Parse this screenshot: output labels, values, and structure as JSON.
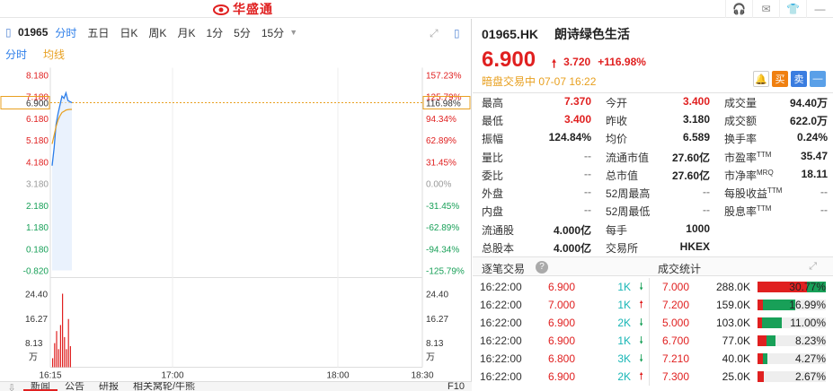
{
  "app": {
    "title": "华盛通",
    "window_icons": [
      "headset-icon",
      "mail-icon",
      "shirt-icon",
      "minimize-icon"
    ]
  },
  "toolbar": {
    "code": "01965",
    "tabs": [
      "分时",
      "五日",
      "日K",
      "周K",
      "月K",
      "1分",
      "5分",
      "15分"
    ],
    "active_tab": "分时"
  },
  "subtabs": {
    "intraday": "分时",
    "average": "均线"
  },
  "chart_data": {
    "type": "line",
    "price_axis_left": [
      "8.180",
      "7.180",
      "6.900",
      "6.180",
      "5.180",
      "4.180",
      "3.180",
      "2.180",
      "1.180",
      "0.180",
      "-0.820"
    ],
    "price_axis_right": [
      "157.23%",
      "125.79%",
      "116.98%",
      "94.34%",
      "62.89%",
      "31.45%",
      "0.00%",
      "-31.45%",
      "-62.89%",
      "-94.34%",
      "-125.79%"
    ],
    "volume_axis": [
      "24.40",
      "16.27",
      "8.13",
      "万"
    ],
    "volume_axis_right": [
      "24.40",
      "16.27",
      "8.13",
      "万"
    ],
    "time_labels": [
      "16:15",
      "17:00",
      "18:00",
      "18:30"
    ],
    "prev_close": 3.18,
    "current": 6.9,
    "ylim": [
      -0.82,
      8.18
    ],
    "price_series": [
      {
        "name": "price",
        "values": [
          4.0,
          4.8,
          5.9,
          6.4,
          6.8,
          7.2,
          7.1,
          7.35,
          7.0,
          6.95,
          6.9
        ]
      },
      {
        "name": "avg",
        "values": [
          5.0,
          5.4,
          5.8,
          6.1,
          6.3,
          6.45,
          6.5,
          6.56,
          6.58,
          6.59,
          6.59
        ]
      }
    ],
    "volume_series": [
      3.0,
      8.0,
      12.0,
      6.0,
      14.0,
      24.4,
      10.0,
      6.0,
      16.0,
      7.0
    ]
  },
  "bottom_tabs": [
    "新闻",
    "公告",
    "研报",
    "相关窝轮/牛熊"
  ],
  "bottom_right": "F10",
  "stock": {
    "code": "01965.HK",
    "name": "朗诗绿色生活",
    "price": "6.900",
    "change": "3.720",
    "change_pct": "+116.98%",
    "status": "暗盘交易中 07-07 16:22",
    "buy_label": "买",
    "sell_label": "卖",
    "more_label": "—"
  },
  "quote": [
    [
      {
        "l": "最高",
        "v": "7.370",
        "c": "red"
      },
      {
        "l": "今开",
        "v": "3.400",
        "c": "red"
      },
      {
        "l": "成交量",
        "v": "94.40万",
        "c": "dark"
      }
    ],
    [
      {
        "l": "最低",
        "v": "3.400",
        "c": "red"
      },
      {
        "l": "昨收",
        "v": "3.180",
        "c": "dark"
      },
      {
        "l": "成交额",
        "v": "622.0万",
        "c": "dark"
      }
    ],
    [
      {
        "l": "振幅",
        "v": "124.84%",
        "c": "dark"
      },
      {
        "l": "均价",
        "v": "6.589",
        "c": "dark"
      },
      {
        "l": "换手率",
        "v": "0.24%",
        "c": "dark"
      }
    ],
    [
      {
        "l": "量比",
        "v": "--",
        "c": "gray"
      },
      {
        "l": "流通市值",
        "v": "27.60亿",
        "c": "dark"
      },
      {
        "l": "市盈率TTM",
        "v": "35.47",
        "c": "dark"
      }
    ],
    [
      {
        "l": "委比",
        "v": "--",
        "c": "gray"
      },
      {
        "l": "总市值",
        "v": "27.60亿",
        "c": "dark"
      },
      {
        "l": "市净率MRQ",
        "v": "18.11",
        "c": "dark"
      }
    ],
    [
      {
        "l": "外盘",
        "v": "--",
        "c": "gray"
      },
      {
        "l": "52周最高",
        "v": "--",
        "c": "gray"
      },
      {
        "l": "每股收益TTM",
        "v": "--",
        "c": "gray"
      }
    ],
    [
      {
        "l": "内盘",
        "v": "--",
        "c": "gray"
      },
      {
        "l": "52周最低",
        "v": "--",
        "c": "gray"
      },
      {
        "l": "股息率TTM",
        "v": "--",
        "c": "gray"
      }
    ],
    [
      {
        "l": "流通股",
        "v": "4.000亿",
        "c": "dark"
      },
      {
        "l": "每手",
        "v": "1000",
        "c": "dark"
      },
      {
        "l": "",
        "v": "",
        "c": "dark"
      }
    ],
    [
      {
        "l": "总股本",
        "v": "4.000亿",
        "c": "dark"
      },
      {
        "l": "交易所",
        "v": "HKEX",
        "c": "dark"
      },
      {
        "l": "",
        "v": "",
        "c": "dark"
      }
    ]
  ],
  "trade_head": {
    "ticks": "逐笔交易",
    "stats": "成交统计",
    "help": "?"
  },
  "trades": [
    {
      "time": "16:22:00",
      "price": "6.900",
      "vol": "1K",
      "dir": "down"
    },
    {
      "time": "16:22:00",
      "price": "7.000",
      "vol": "1K",
      "dir": "up"
    },
    {
      "time": "16:22:00",
      "price": "6.900",
      "vol": "2K",
      "dir": "down"
    },
    {
      "time": "16:22:00",
      "price": "6.900",
      "vol": "1K",
      "dir": "down"
    },
    {
      "time": "16:22:00",
      "price": "6.800",
      "vol": "3K",
      "dir": "down"
    },
    {
      "time": "16:22:00",
      "price": "6.900",
      "vol": "2K",
      "dir": "up"
    }
  ],
  "stats": [
    {
      "price": "7.000",
      "vol": "288.0K",
      "pct": "30.77%",
      "buy": 0.72,
      "sell": 0.28
    },
    {
      "price": "7.200",
      "vol": "159.0K",
      "pct": "16.99%",
      "buy": 0.15,
      "sell": 0.85
    },
    {
      "price": "5.000",
      "vol": "103.0K",
      "pct": "11.00%",
      "buy": 0.2,
      "sell": 0.8
    },
    {
      "price": "6.700",
      "vol": "77.0K",
      "pct": "8.23%",
      "buy": 0.5,
      "sell": 0.5
    },
    {
      "price": "7.210",
      "vol": "40.0K",
      "pct": "4.27%",
      "buy": 0.6,
      "sell": 0.4
    },
    {
      "price": "7.300",
      "vol": "25.0K",
      "pct": "2.67%",
      "buy": 1.0,
      "sell": 0.0
    }
  ],
  "colors": {
    "up": "#e02020",
    "down": "#18a058",
    "accent": "#2b7de9",
    "avg": "#e8a020"
  }
}
